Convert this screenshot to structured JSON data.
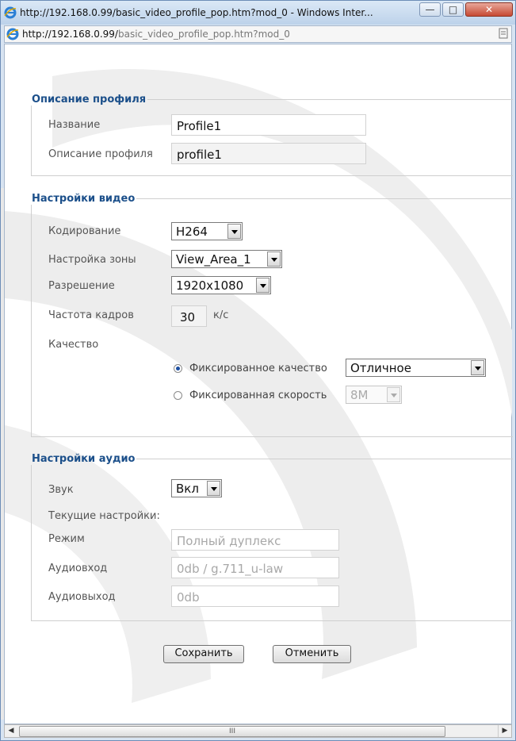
{
  "window": {
    "title": "http://192.168.0.99/basic_video_profile_pop.htm?mod_0 - Windows Inter...",
    "url_host": "http://192.168.0.99/",
    "url_path": "basic_video_profile_pop.htm?mod_0",
    "min_glyph": "—",
    "max_glyph": "□",
    "close_glyph": "✕"
  },
  "profile": {
    "legend": "Описание профиля",
    "name_label": "Название",
    "name_value": "Profile1",
    "desc_label": "Описание профиля",
    "desc_value": "profile1"
  },
  "video": {
    "legend": "Настройки видео",
    "codec_label": "Кодирование",
    "codec_value": "H264",
    "zone_label": "Настройка зоны",
    "zone_value": "View_Area_1",
    "resolution_label": "Разрешение",
    "resolution_value": "1920x1080",
    "fps_label": "Частота кадров",
    "fps_value": "30",
    "fps_unit": "к/с",
    "quality_label": "Качество",
    "fixed_quality_label": "Фиксированное качество",
    "fixed_quality_value": "Отличное",
    "fixed_bitrate_label": "Фиксированная скорость",
    "fixed_bitrate_value": "8M"
  },
  "audio": {
    "legend": "Настройки аудио",
    "sound_label": "Звук",
    "sound_value": "Вкл",
    "current_label": "Текущие настройки:",
    "mode_label": "Режим",
    "mode_value": "Полный дуплекс",
    "in_label": "Аудиовход",
    "in_value": "0db / g.711_u-law",
    "out_label": "Аудиовыход",
    "out_value": "0db"
  },
  "actions": {
    "save": "Сохранить",
    "cancel": "Отменить"
  },
  "scrollbar": {
    "thumb_grip": "III"
  },
  "colors": {
    "legend": "#1b4f8a",
    "close": "#c74a33",
    "watermark": "#e3e3e3"
  }
}
